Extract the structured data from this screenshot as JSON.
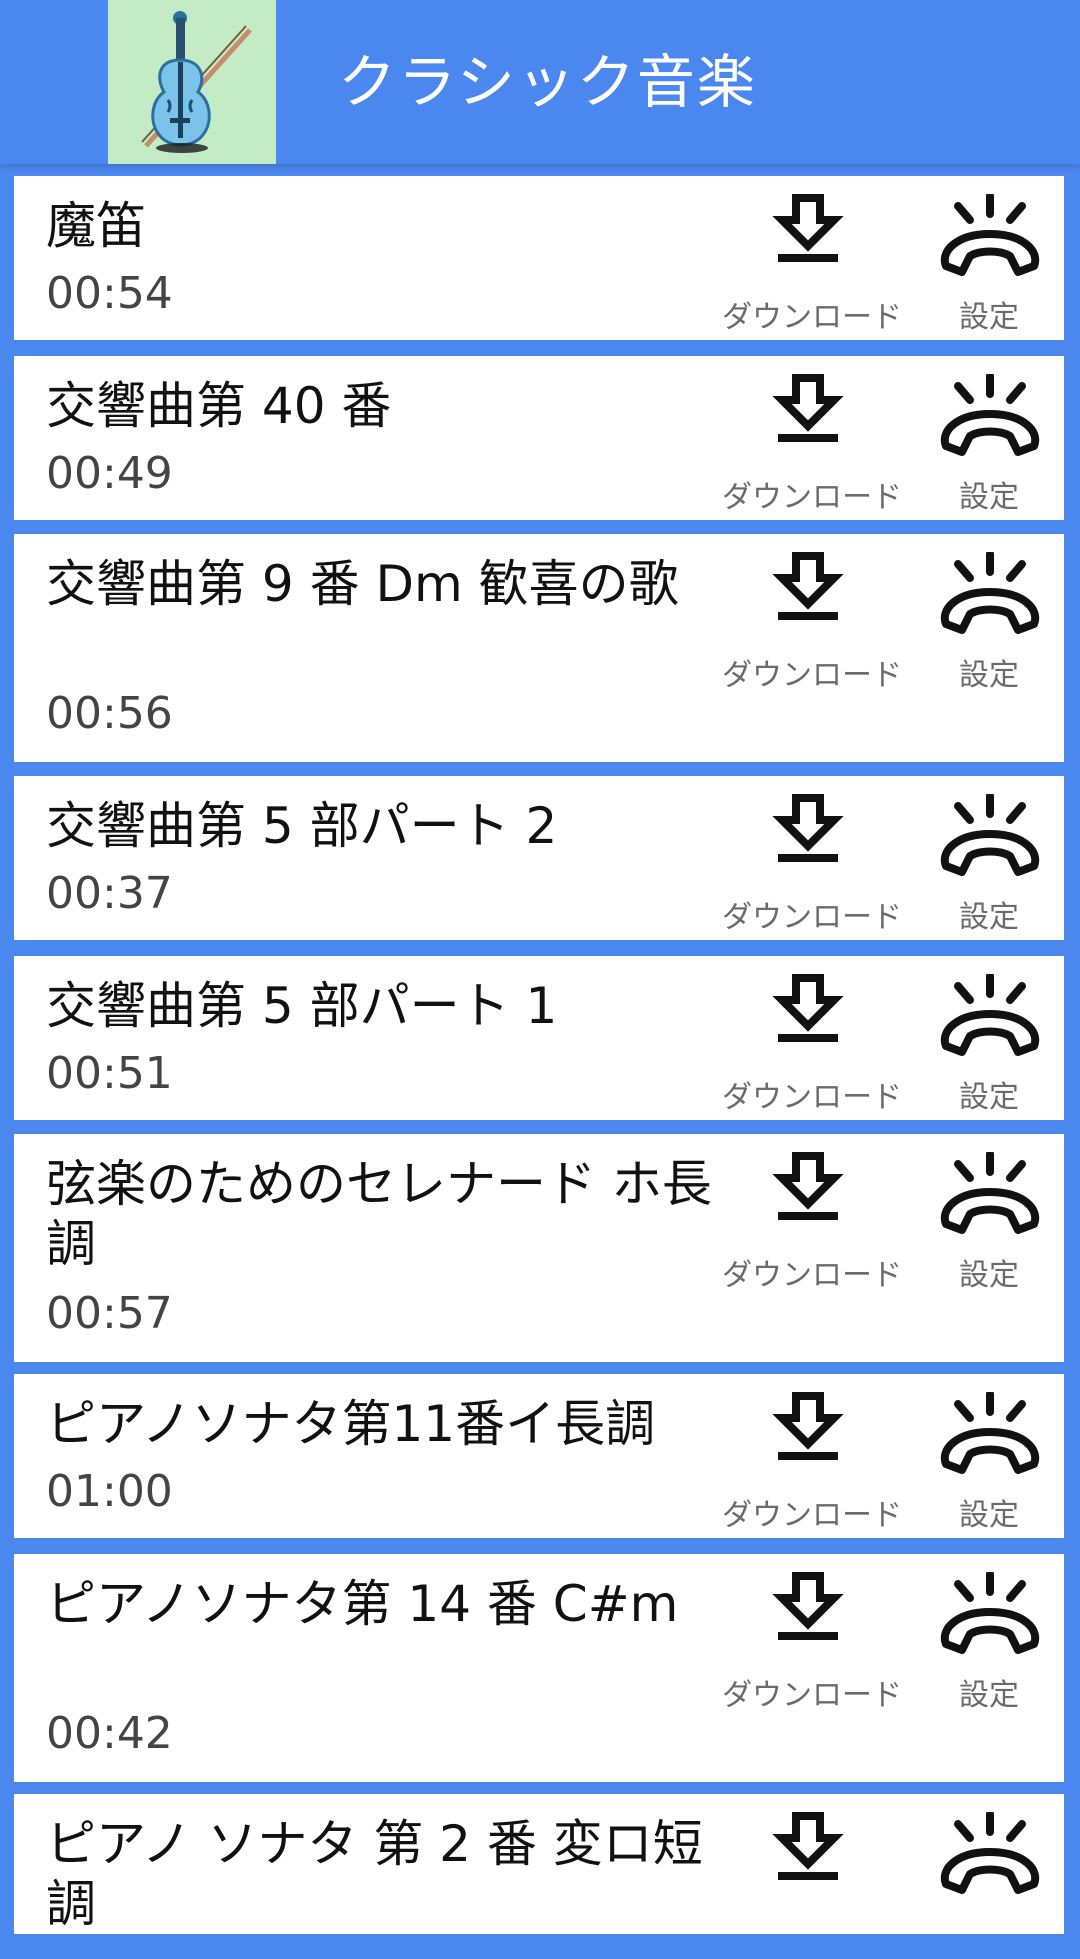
{
  "app": {
    "title": "クラシック音楽",
    "logo_icon": "violin-icon",
    "accent_color": "#4a87ee"
  },
  "labels": {
    "download": "ダウンロード",
    "settings": "設定"
  },
  "icons": {
    "download": "download-icon",
    "settings": "ringing-phone-icon"
  },
  "songs": [
    {
      "title": "魔笛",
      "duration": "00:54"
    },
    {
      "title": "交響曲第 40 番",
      "duration": "00:49"
    },
    {
      "title": "交響曲第 9 番 Dm 歓喜の歌",
      "duration": "00:56"
    },
    {
      "title": "交響曲第 5 部パート 2",
      "duration": "00:37"
    },
    {
      "title": "交響曲第 5 部パート 1",
      "duration": "00:51"
    },
    {
      "title": "弦楽のためのセレナード ホ長調",
      "duration": "00:57"
    },
    {
      "title": "ピアノソナタ第11番イ長調",
      "duration": "01:00"
    },
    {
      "title": "ピアノソナタ第 14 番 C#m",
      "duration": "00:42"
    },
    {
      "title": "ピアノ ソナタ 第 2 番 変ロ短調",
      "duration": ""
    }
  ]
}
